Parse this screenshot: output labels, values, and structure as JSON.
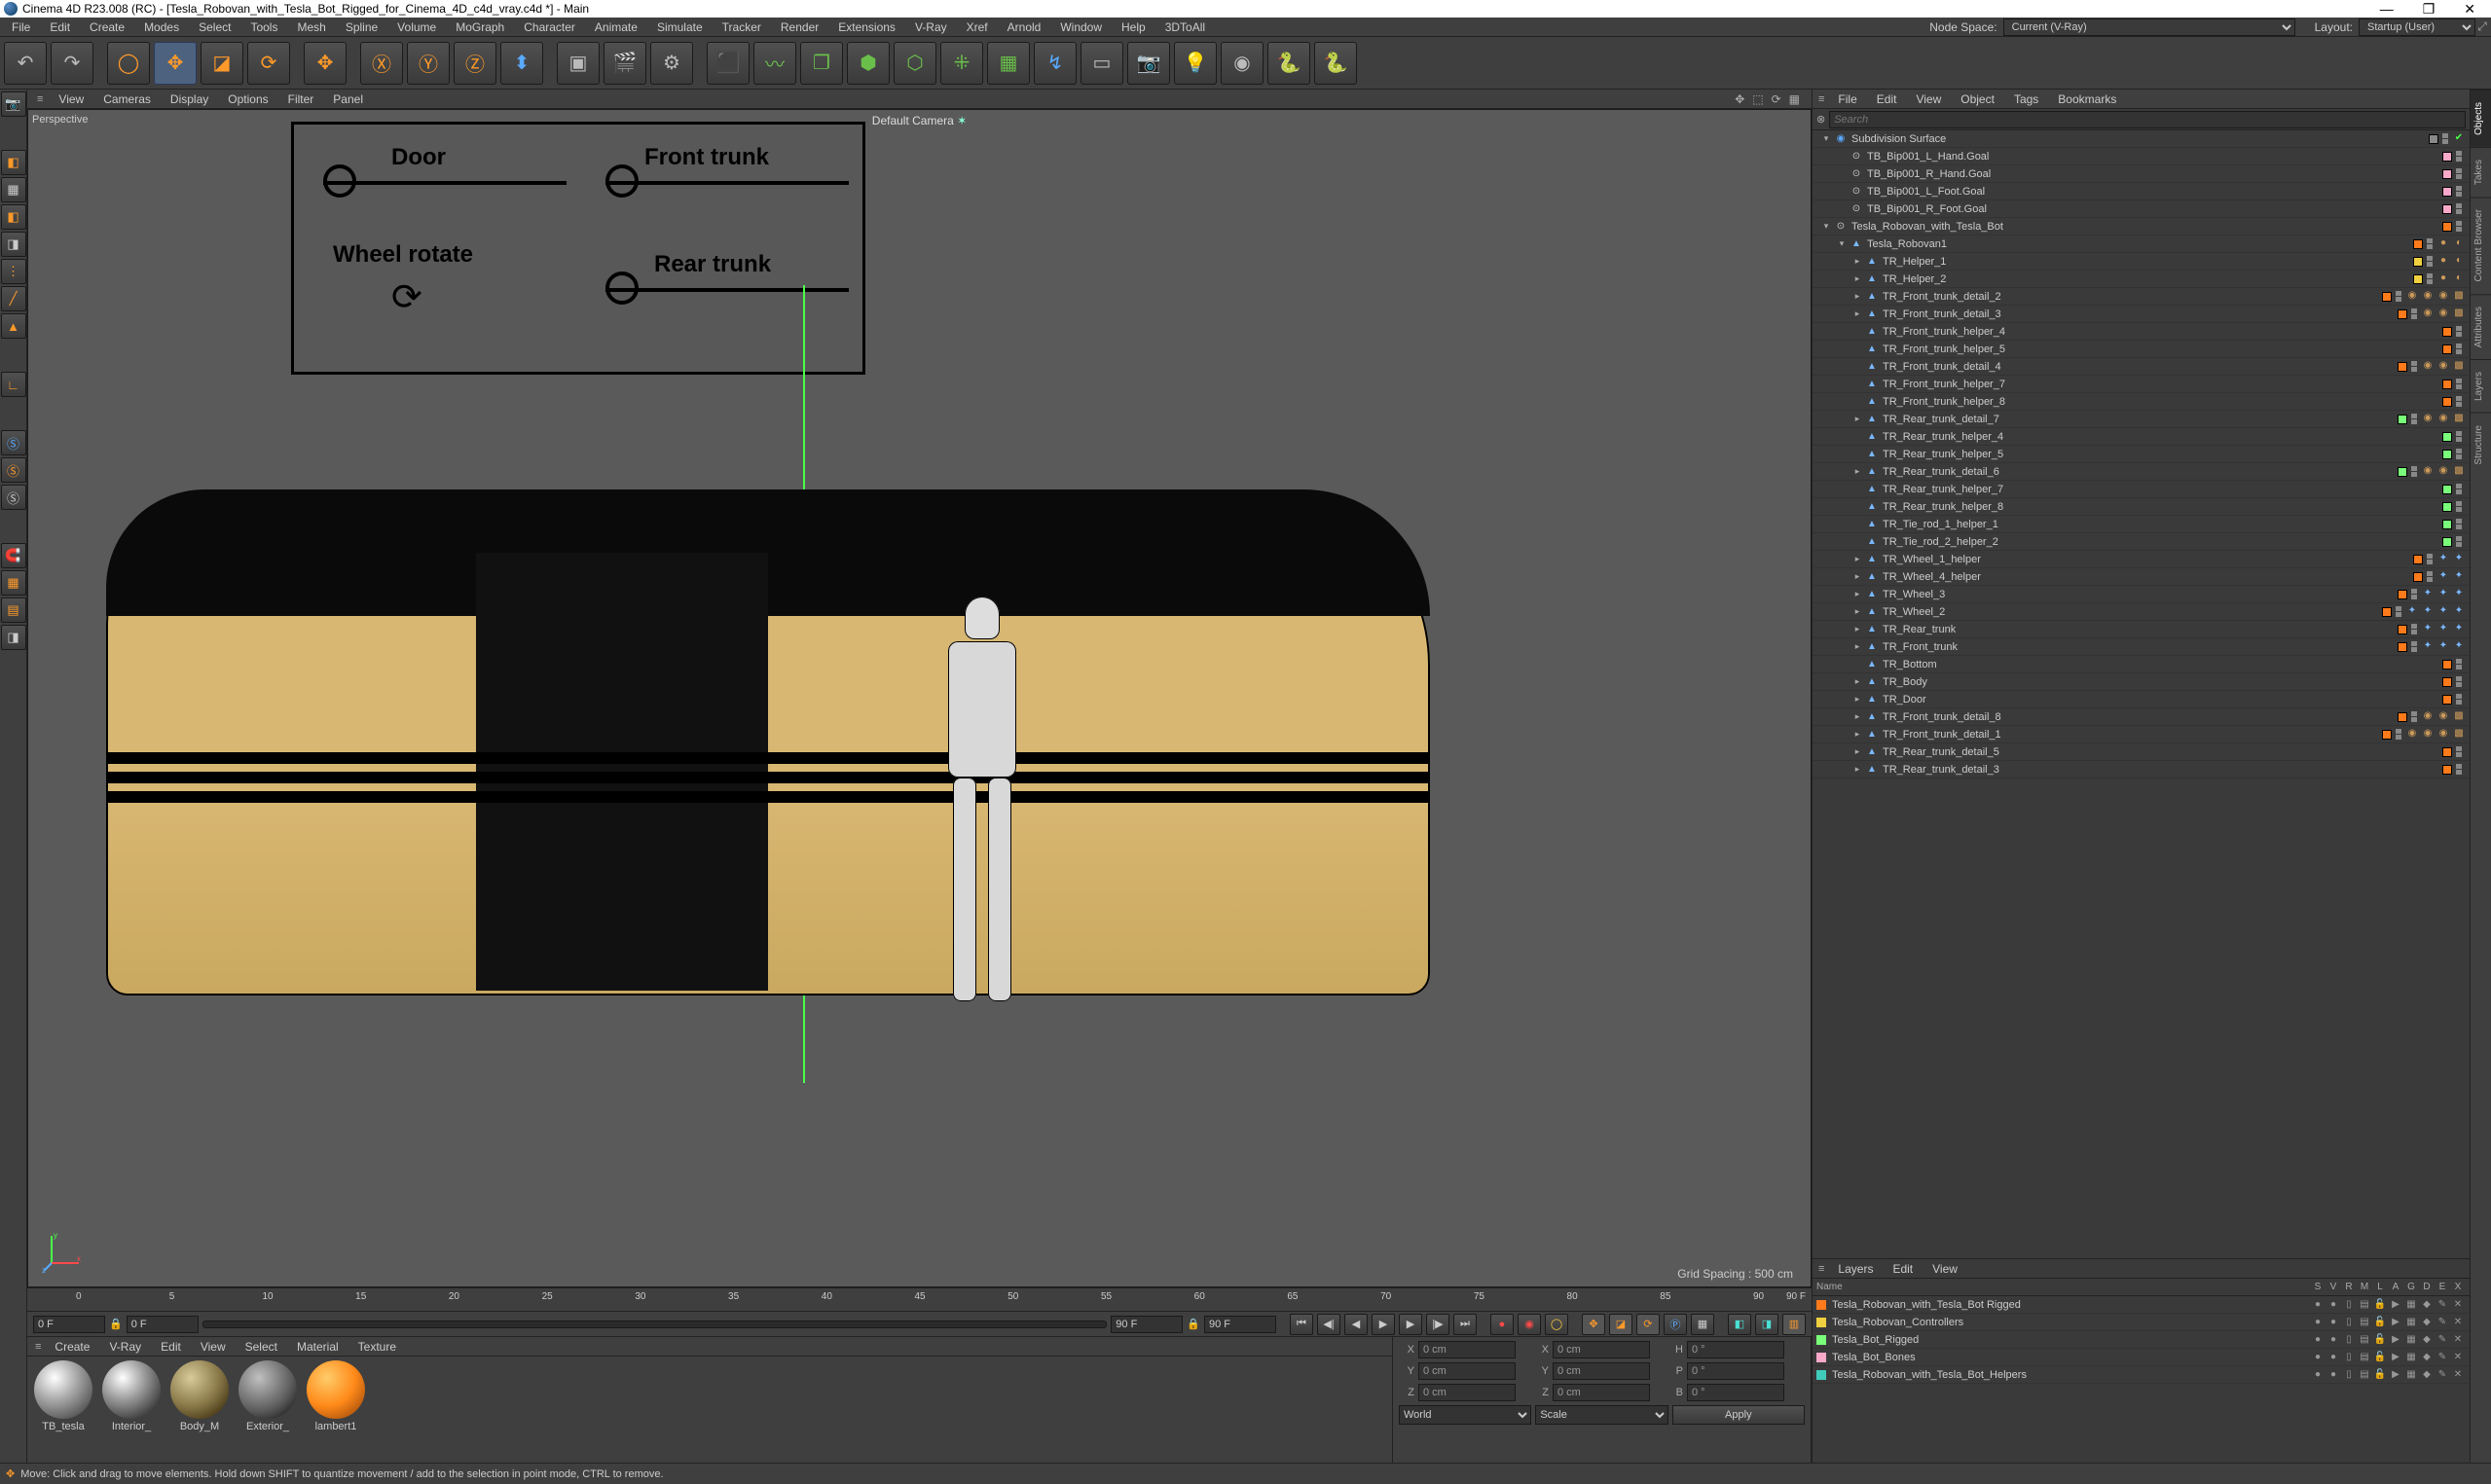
{
  "titlebar": {
    "text": "Cinema 4D R23.008 (RC) - [Tesla_Robovan_with_Tesla_Bot_Rigged_for_Cinema_4D_c4d_vray.c4d *] - Main"
  },
  "window_controls": {
    "min": "—",
    "max": "❐",
    "close": "✕"
  },
  "menubar": [
    "File",
    "Edit",
    "Create",
    "Modes",
    "Select",
    "Tools",
    "Mesh",
    "Spline",
    "Volume",
    "MoGraph",
    "Character",
    "Animate",
    "Simulate",
    "Tracker",
    "Render",
    "Extensions",
    "V-Ray",
    "Xref",
    "Arnold",
    "Window",
    "Help",
    "3DToAll"
  ],
  "menubar_right": {
    "layout_label": "Layout:",
    "layout_value": "Startup (User)"
  },
  "right_header": {
    "node_space_label": "Node Space:",
    "node_space_value": "Current (V-Ray)"
  },
  "viewport_menubar": [
    "View",
    "Cameras",
    "Display",
    "Options",
    "Filter",
    "Panel"
  ],
  "viewport": {
    "perspective": "Perspective",
    "camera": "Default Camera",
    "grid_spacing": "Grid Spacing : 500 cm",
    "control_panel": {
      "door": "Door",
      "front_trunk": "Front trunk",
      "wheel_rotate": "Wheel rotate",
      "rear_trunk": "Rear trunk"
    }
  },
  "timeline": {
    "ticks": [
      "0",
      "5",
      "10",
      "15",
      "20",
      "25",
      "30",
      "35",
      "40",
      "45",
      "50",
      "55",
      "60",
      "65",
      "70",
      "75",
      "80",
      "85",
      "90"
    ],
    "end": "90 F"
  },
  "playback": {
    "start": "0 F",
    "startRange": "0 F",
    "end": "90 F",
    "endRange": "90 F"
  },
  "materials_menu": [
    "Create",
    "V-Ray",
    "Edit",
    "View",
    "Select",
    "Material",
    "Texture"
  ],
  "materials": [
    {
      "name": "TB_tesla",
      "grad": "radial-gradient(circle at 35% 30%, #fff 0%, #a8a8a8 40%, #555 80%)"
    },
    {
      "name": "Interior_",
      "grad": "radial-gradient(circle at 35% 30%, #fff 0%, #999 40%, #3a3a3a 80%)"
    },
    {
      "name": "Body_M",
      "grad": "radial-gradient(circle at 35% 30%, #dacb9a 0%, #8a7a4a 50%, #3a2a0a 90%)"
    },
    {
      "name": "Exterior_",
      "grad": "radial-gradient(circle at 35% 30%, #c0c0c0 0%, #5a5a5a 60%, #1a1a1a 90%)"
    },
    {
      "name": "lambert1",
      "grad": "radial-gradient(circle at 35% 30%, #ffcc6a 0%, #ff8a1a 50%, #a04a0a 90%)"
    }
  ],
  "coords": {
    "x_pos": "0 cm",
    "x_siz": "0 cm",
    "h": "0 °",
    "y_pos": "0 cm",
    "y_siz": "0 cm",
    "p": "0 °",
    "z_pos": "0 cm",
    "z_siz": "0 cm",
    "b": "0 °",
    "space": "World",
    "mode": "Scale",
    "apply": "Apply"
  },
  "objects_menu": [
    "File",
    "Edit",
    "View",
    "Object",
    "Tags",
    "Bookmarks"
  ],
  "search_placeholder": "Search",
  "object_tree": [
    {
      "indent": 0,
      "exp": "-",
      "icon": "sd",
      "name": "Subdivision Surface",
      "color": "",
      "tags": [
        "green-check"
      ]
    },
    {
      "indent": 1,
      "exp": "",
      "icon": "null",
      "name": "TB_Bip001_L_Hand.Goal",
      "color": "pink",
      "tags": []
    },
    {
      "indent": 1,
      "exp": "",
      "icon": "null",
      "name": "TB_Bip001_R_Hand.Goal",
      "color": "pink",
      "tags": []
    },
    {
      "indent": 1,
      "exp": "",
      "icon": "null",
      "name": "TB_Bip001_L_Foot.Goal",
      "color": "pink",
      "tags": []
    },
    {
      "indent": 1,
      "exp": "",
      "icon": "null",
      "name": "TB_Bip001_R_Foot.Goal",
      "color": "pink",
      "tags": []
    },
    {
      "indent": 0,
      "exp": "-",
      "icon": "null",
      "name": "Tesla_Robovan_with_Tesla_Bot",
      "color": "orange",
      "tags": []
    },
    {
      "indent": 1,
      "exp": "-",
      "icon": "poly",
      "name": "Tesla_Robovan1",
      "color": "orange",
      "tags": [
        "mat-ball",
        "phong"
      ]
    },
    {
      "indent": 2,
      "exp": "+",
      "icon": "poly",
      "name": "TR_Helper_1",
      "color": "yellow",
      "tags": [
        "mat-ball",
        "phong"
      ]
    },
    {
      "indent": 2,
      "exp": "+",
      "icon": "poly",
      "name": "TR_Helper_2",
      "color": "yellow",
      "tags": [
        "mat-ball",
        "phong"
      ]
    },
    {
      "indent": 2,
      "exp": "+",
      "icon": "poly",
      "name": "TR_Front_trunk_detail_2",
      "color": "orange",
      "tags": [
        "mat",
        "mat",
        "mat",
        "chk"
      ]
    },
    {
      "indent": 2,
      "exp": "+",
      "icon": "poly",
      "name": "TR_Front_trunk_detail_3",
      "color": "orange",
      "tags": [
        "mat",
        "mat",
        "chk"
      ]
    },
    {
      "indent": 2,
      "exp": "",
      "icon": "poly",
      "name": "TR_Front_trunk_helper_4",
      "color": "orange",
      "tags": []
    },
    {
      "indent": 2,
      "exp": "",
      "icon": "poly",
      "name": "TR_Front_trunk_helper_5",
      "color": "orange",
      "tags": []
    },
    {
      "indent": 2,
      "exp": "",
      "icon": "poly",
      "name": "TR_Front_trunk_detail_4",
      "color": "orange",
      "tags": [
        "mat",
        "mat",
        "chk"
      ]
    },
    {
      "indent": 2,
      "exp": "",
      "icon": "poly",
      "name": "TR_Front_trunk_helper_7",
      "color": "orange",
      "tags": []
    },
    {
      "indent": 2,
      "exp": "",
      "icon": "poly",
      "name": "TR_Front_trunk_helper_8",
      "color": "orange",
      "tags": []
    },
    {
      "indent": 2,
      "exp": "+",
      "icon": "poly",
      "name": "TR_Rear_trunk_detail_7",
      "color": "green",
      "tags": [
        "mat",
        "mat",
        "chk"
      ]
    },
    {
      "indent": 2,
      "exp": "",
      "icon": "poly",
      "name": "TR_Rear_trunk_helper_4",
      "color": "green",
      "tags": []
    },
    {
      "indent": 2,
      "exp": "",
      "icon": "poly",
      "name": "TR_Rear_trunk_helper_5",
      "color": "green",
      "tags": []
    },
    {
      "indent": 2,
      "exp": "+",
      "icon": "poly",
      "name": "TR_Rear_trunk_detail_6",
      "color": "green",
      "tags": [
        "mat",
        "mat",
        "chk"
      ]
    },
    {
      "indent": 2,
      "exp": "",
      "icon": "poly",
      "name": "TR_Rear_trunk_helper_7",
      "color": "green",
      "tags": []
    },
    {
      "indent": 2,
      "exp": "",
      "icon": "poly",
      "name": "TR_Rear_trunk_helper_8",
      "color": "green",
      "tags": []
    },
    {
      "indent": 2,
      "exp": "",
      "icon": "poly",
      "name": "TR_Tie_rod_1_helper_1",
      "color": "green",
      "tags": []
    },
    {
      "indent": 2,
      "exp": "",
      "icon": "poly",
      "name": "TR_Tie_rod_2_helper_2",
      "color": "green",
      "tags": []
    },
    {
      "indent": 2,
      "exp": "+",
      "icon": "poly",
      "name": "TR_Wheel_1_helper",
      "color": "orange",
      "tags": [
        "xpr",
        "xpr"
      ]
    },
    {
      "indent": 2,
      "exp": "+",
      "icon": "poly",
      "name": "TR_Wheel_4_helper",
      "color": "orange",
      "tags": [
        "xpr",
        "xpr"
      ]
    },
    {
      "indent": 2,
      "exp": "+",
      "icon": "poly",
      "name": "TR_Wheel_3",
      "color": "orange",
      "tags": [
        "xpr",
        "xpr",
        "xpr"
      ]
    },
    {
      "indent": 2,
      "exp": "+",
      "icon": "poly",
      "name": "TR_Wheel_2",
      "color": "orange",
      "tags": [
        "xpr",
        "xpr",
        "xpr",
        "xpr"
      ]
    },
    {
      "indent": 2,
      "exp": "+",
      "icon": "poly",
      "name": "TR_Rear_trunk",
      "color": "orange",
      "tags": [
        "xpr",
        "xpr",
        "xpr"
      ]
    },
    {
      "indent": 2,
      "exp": "+",
      "icon": "poly",
      "name": "TR_Front_trunk",
      "color": "orange",
      "tags": [
        "xpr",
        "xpr",
        "xpr"
      ]
    },
    {
      "indent": 2,
      "exp": "",
      "icon": "poly",
      "name": "TR_Bottom",
      "color": "orange",
      "tags": []
    },
    {
      "indent": 2,
      "exp": "+",
      "icon": "poly",
      "name": "TR_Body",
      "color": "orange",
      "tags": []
    },
    {
      "indent": 2,
      "exp": "+",
      "icon": "poly",
      "name": "TR_Door",
      "color": "orange",
      "tags": []
    },
    {
      "indent": 2,
      "exp": "+",
      "icon": "poly",
      "name": "TR_Front_trunk_detail_8",
      "color": "orange",
      "tags": [
        "mat",
        "mat",
        "chk"
      ]
    },
    {
      "indent": 2,
      "exp": "+",
      "icon": "poly",
      "name": "TR_Front_trunk_detail_1",
      "color": "orange",
      "tags": [
        "mat",
        "mat",
        "mat",
        "chk"
      ]
    },
    {
      "indent": 2,
      "exp": "+",
      "icon": "poly",
      "name": "TR_Rear_trunk_detail_5",
      "color": "orange",
      "tags": []
    },
    {
      "indent": 2,
      "exp": "+",
      "icon": "poly",
      "name": "TR_Rear_trunk_detail_3",
      "color": "orange",
      "tags": []
    }
  ],
  "layers_menu": [
    "Layers",
    "Edit",
    "View"
  ],
  "layers_header": [
    "Name",
    "S",
    "V",
    "R",
    "M",
    "L",
    "A",
    "G",
    "D",
    "E",
    "X"
  ],
  "layers": [
    {
      "color": "orange",
      "name": "Tesla_Robovan_with_Tesla_Bot Rigged"
    },
    {
      "color": "yellow",
      "name": "Tesla_Robovan_Controllers"
    },
    {
      "color": "green",
      "name": "Tesla_Bot_Rigged"
    },
    {
      "color": "pink",
      "name": "Tesla_Bot_Bones"
    },
    {
      "color": "teal",
      "name": "Tesla_Robovan_with_Tesla_Bot_Helpers"
    }
  ],
  "right_tabs": [
    "Objects",
    "Takes",
    "Content Browser",
    "Attributes",
    "Layers",
    "Structure"
  ],
  "statusbar": "Move: Click and drag to move elements. Hold down SHIFT to quantize movement / add to the selection in point mode, CTRL to remove."
}
